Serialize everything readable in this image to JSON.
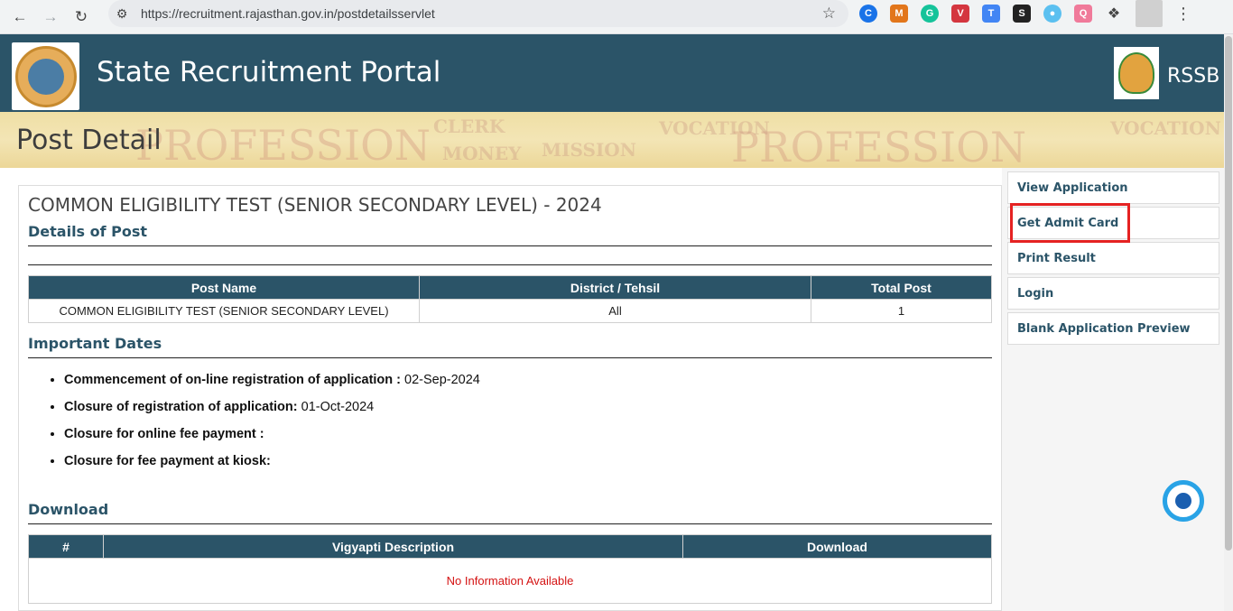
{
  "browser": {
    "url": "https://recruitment.rajasthan.gov.in/postdetailsservlet"
  },
  "header": {
    "title": "State Recruitment Portal",
    "right_label": "RSSB"
  },
  "page_title": "Post Detail",
  "post": {
    "heading": "COMMON ELIGIBILITY TEST (SENIOR SECONDARY LEVEL) - 2024",
    "details_title": "Details of Post",
    "table_headers": [
      "Post Name",
      "District / Tehsil",
      "Total Post"
    ],
    "rows": [
      [
        "COMMON ELIGIBILITY TEST (SENIOR SECONDARY LEVEL)",
        "All",
        "1"
      ]
    ]
  },
  "dates": {
    "title": "Important Dates",
    "items": [
      {
        "label": "Commencement of on-line registration of application :",
        "value": " 02-Sep-2024"
      },
      {
        "label": "Closure of registration of application:",
        "value": " 01-Oct-2024"
      },
      {
        "label": "Closure for online fee payment :",
        "value": ""
      },
      {
        "label": "Closure for fee payment at kiosk:",
        "value": ""
      }
    ]
  },
  "download": {
    "title": "Download",
    "headers": [
      "#",
      "Vigyapti Description",
      "Download"
    ],
    "empty_text": "No Information Available"
  },
  "sidebar": {
    "items": [
      {
        "label": "View Application"
      },
      {
        "label": "Get Admit Card"
      },
      {
        "label": "Print Result"
      },
      {
        "label": "Login"
      },
      {
        "label": "Blank Application Preview"
      }
    ]
  },
  "colors": {
    "header_bg": "#2b5468",
    "highlight": "#e52222",
    "error_text": "#d41212"
  }
}
